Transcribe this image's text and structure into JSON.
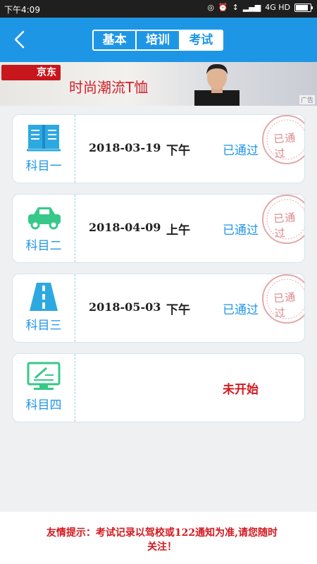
{
  "status_bar": {
    "time": "下午4:09",
    "network": "4G HD"
  },
  "header": {
    "tabs": [
      {
        "label": "基本",
        "active": false
      },
      {
        "label": "培训",
        "active": false
      },
      {
        "label": "考试",
        "active": true
      }
    ]
  },
  "banner": {
    "logo": "京东",
    "slogan": "时尚潮流T恤",
    "ad_label": "广告"
  },
  "exams": [
    {
      "subject": "科目一",
      "icon": "book-icon",
      "date": "2018-03-19",
      "period": "下午",
      "status": "已通过",
      "stamp": "已通过"
    },
    {
      "subject": "科目二",
      "icon": "car-icon",
      "date": "2018-04-09",
      "period": "上午",
      "status": "已通过",
      "stamp": "已通过"
    },
    {
      "subject": "科目三",
      "icon": "road-icon",
      "date": "2018-05-03",
      "period": "下午",
      "status": "已通过",
      "stamp": "已通过"
    },
    {
      "subject": "科目四",
      "icon": "monitor-icon",
      "date": "",
      "period": "",
      "status": "未开始",
      "stamp": ""
    }
  ],
  "footer": {
    "tip": "友情提示：考试记录以驾校或122通知为准,请您随时关注！"
  },
  "colors": {
    "primary": "#1e96e6",
    "alert": "#d3181f",
    "stamp": "#d98a8d"
  }
}
